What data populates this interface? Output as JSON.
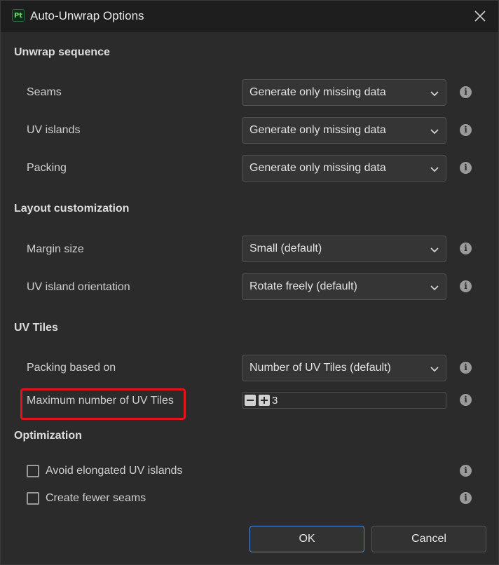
{
  "window": {
    "app_icon_text": "Pt",
    "title": "Auto-Unwrap Options"
  },
  "sections": {
    "unwrap_sequence": {
      "title": "Unwrap sequence",
      "rows": [
        {
          "label": "Seams",
          "value": "Generate only missing data"
        },
        {
          "label": "UV islands",
          "value": "Generate only missing data"
        },
        {
          "label": "Packing",
          "value": "Generate only missing data"
        }
      ]
    },
    "layout_customization": {
      "title": "Layout customization",
      "rows": [
        {
          "label": "Margin size",
          "value": "Small (default)"
        },
        {
          "label": "UV island orientation",
          "value": "Rotate freely (default)"
        }
      ]
    },
    "uv_tiles": {
      "title": "UV Tiles",
      "packing_label": "Packing based on",
      "packing_value": "Number of UV Tiles (default)",
      "max_label": "Maximum number of UV Tiles",
      "max_value": "3"
    },
    "optimization": {
      "title": "Optimization",
      "checks": [
        {
          "label": "Avoid elongated UV islands",
          "checked": false
        },
        {
          "label": "Create fewer seams",
          "checked": false
        }
      ]
    }
  },
  "buttons": {
    "ok": "OK",
    "cancel": "Cancel"
  },
  "icons": {
    "info_glyph": "i"
  },
  "colors": {
    "accent": "#4a8fdc",
    "highlight": "#e0141a",
    "brand": "#6fdc6a"
  }
}
